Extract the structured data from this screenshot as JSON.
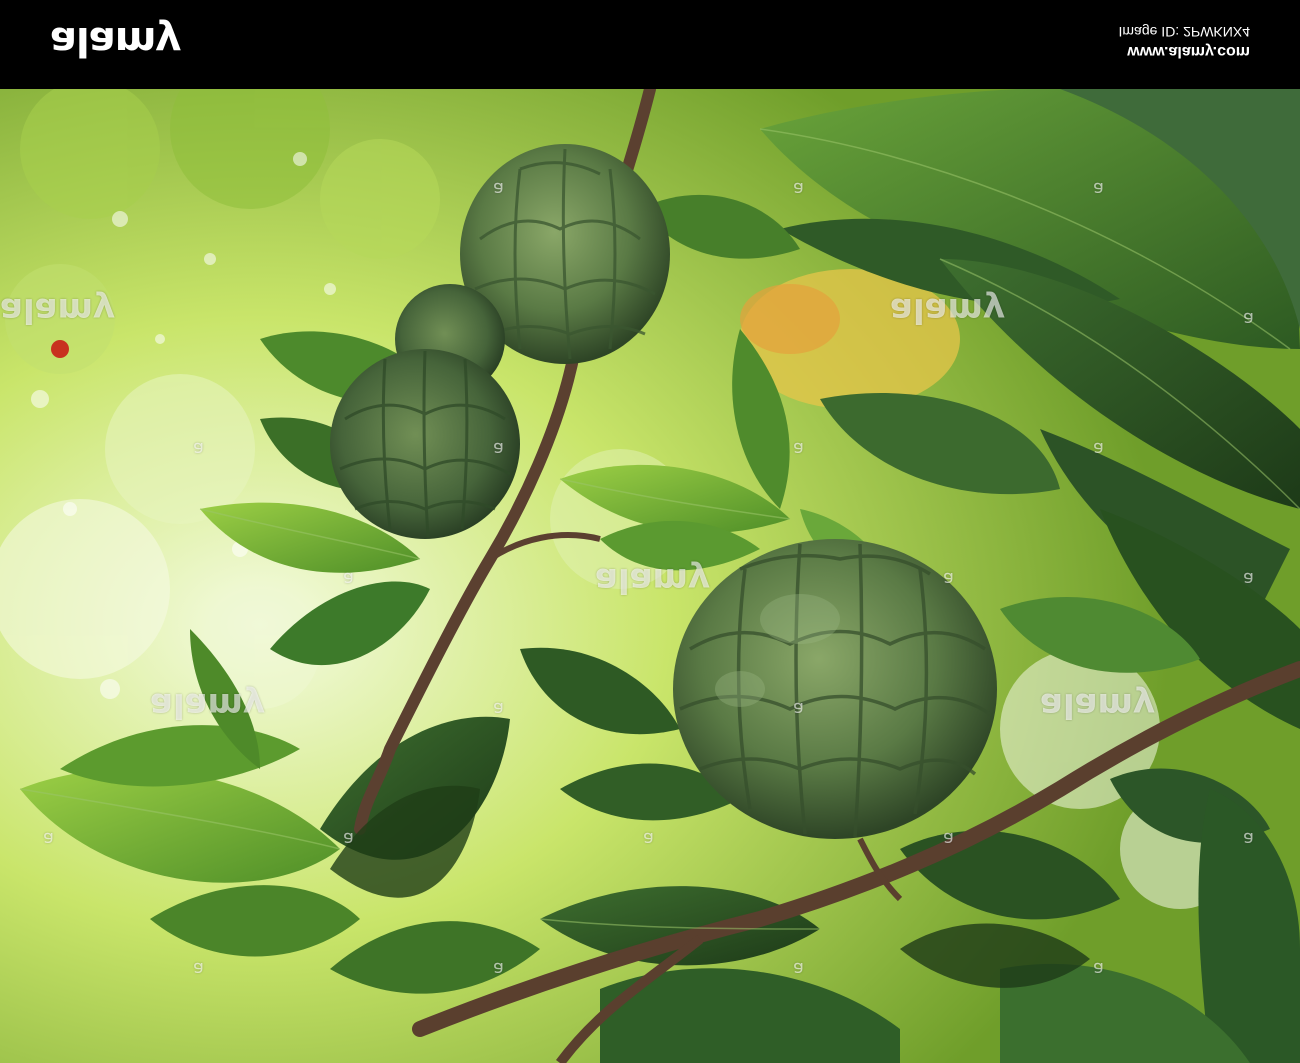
{
  "watermark": {
    "logo": "alamy",
    "site": "www.alamy.com",
    "image_id": "Image ID: 2PWKNX4",
    "tile": "alamy",
    "mark": "a"
  }
}
